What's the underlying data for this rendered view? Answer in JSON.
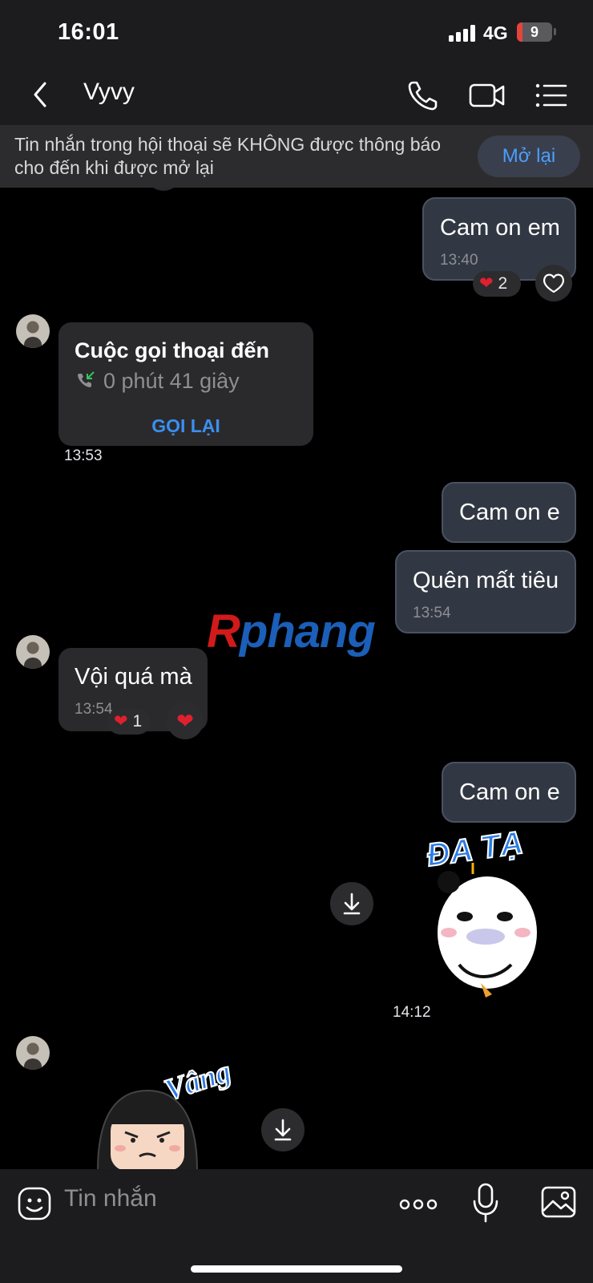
{
  "status_bar": {
    "time": "16:01",
    "network": "4G",
    "battery": "9",
    "battery_level": 0.09
  },
  "header": {
    "contact_name": "Vyvy",
    "back_icon": "chevron-left-icon",
    "call_icon": "phone-icon",
    "video_icon": "video-camera-icon",
    "menu_icon": "list-icon"
  },
  "banner": {
    "text": "Tin nhắn trong hội thoại sẽ KHÔNG được thông báo cho đến khi được mở lại",
    "button": "Mở lại"
  },
  "messages": [
    {
      "type": "out",
      "text": "Cam on em",
      "time": "13:40",
      "reaction_count": "2",
      "reaction": "heart"
    },
    {
      "type": "call",
      "title": "Cuộc gọi thoại đến",
      "duration": "0 phút 41 giây",
      "action": "GỌI LẠI",
      "time": "13:53"
    },
    {
      "type": "out",
      "text": "Cam on e"
    },
    {
      "type": "out",
      "text": "Quên mất tiêu",
      "time": "13:54"
    },
    {
      "type": "in",
      "text": "Vội quá mà",
      "time": "13:54",
      "reaction_count": "1",
      "reaction": "heart"
    },
    {
      "type": "out",
      "text": "Cam on e"
    },
    {
      "type": "sticker",
      "label": "ĐA TẠ",
      "time": "14:12"
    },
    {
      "type": "sticker_in",
      "label": "Vâng"
    }
  ],
  "watermark": {
    "first": "R",
    "rest": "phang"
  },
  "composer": {
    "placeholder": "Tin nhắn",
    "emoji_icon": "emoji-icon",
    "more_icon": "more-dots-icon",
    "mic_icon": "microphone-icon",
    "image_icon": "image-icon"
  },
  "colors": {
    "accent": "#4b9eff",
    "out_bubble": "#323843",
    "in_bubble": "#2a2a2d",
    "heart": "#e0202e"
  }
}
